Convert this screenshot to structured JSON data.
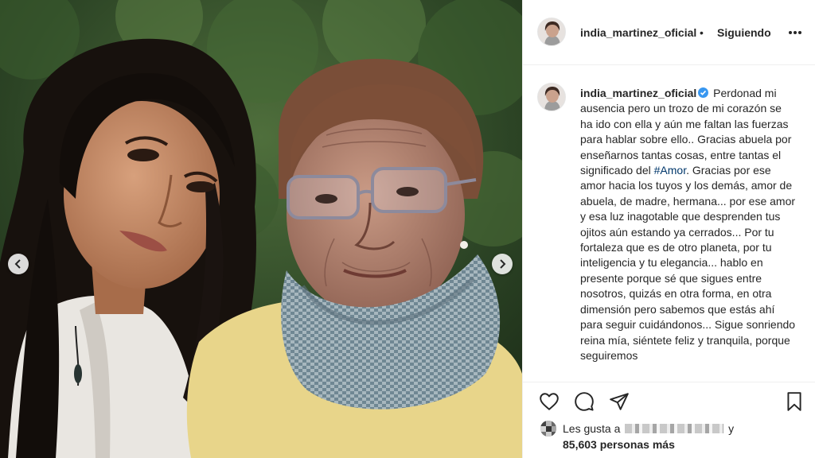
{
  "post": {
    "username": "india_martinez_oficial",
    "separator": "•",
    "follow_status": "Siguiendo",
    "verified": true
  },
  "photo": {
    "description_icon": "photo",
    "prev_icon": "chevron-left-icon",
    "next_icon": "chevron-right-icon"
  },
  "caption": {
    "username": "india_martinez_oficial",
    "text_before_hashtag": "Perdonad mi ausencia pero un trozo de mi corazón se ha ido con ella y aún me faltan las fuerzas para hablar sobre ello.. Gracias abuela por enseñarnos tantas cosas, entre tantas el significado del ",
    "hashtag": "#Amor",
    "text_after_hashtag": ". Gracias por ese amor hacia los tuyos y los demás, amor de abuela, de madre, hermana... por ese amor y esa luz inagotable que desprenden tus ojitos aún estando ya cerrados... Por tu fortaleza que es de otro planeta, por tu inteligencia y tu elegancia... hablo en presente porque sé que sigues entre nosotros, quizás en otra forma, en otra dimensión pero sabemos que estás ahí para seguir cuidándonos... Sigue sonriendo reina mía, siéntete feliz y tranquila, porque seguiremos"
  },
  "actions": {
    "like_icon": "heart-icon",
    "comment_icon": "comment-icon",
    "share_icon": "paper-plane-icon",
    "save_icon": "bookmark-icon"
  },
  "likes": {
    "prefix": "Les gusta a",
    "suffix": "y",
    "count_text": "85,603 personas más"
  },
  "colors": {
    "text": "#262626",
    "hashtag": "#00376b",
    "verified": "#3897f0",
    "border": "#efefef"
  }
}
